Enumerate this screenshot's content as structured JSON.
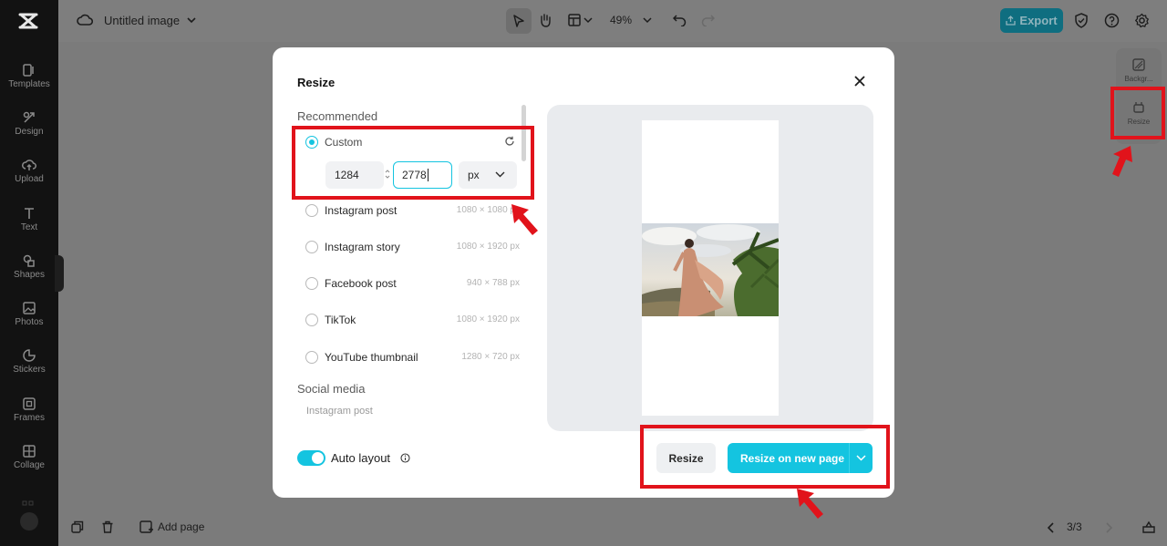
{
  "app": {
    "document_title": "Untitled image",
    "zoom": "49%",
    "export_label": "Export",
    "accent": "#14c4e0",
    "annotation_color": "#e1131b"
  },
  "sidebar": {
    "items": [
      {
        "label": "Templates",
        "icon": "templates-icon"
      },
      {
        "label": "Design",
        "icon": "design-icon"
      },
      {
        "label": "Upload",
        "icon": "upload-icon"
      },
      {
        "label": "Text",
        "icon": "text-icon"
      },
      {
        "label": "Shapes",
        "icon": "shapes-icon"
      },
      {
        "label": "Photos",
        "icon": "photos-icon"
      },
      {
        "label": "Stickers",
        "icon": "stickers-icon"
      },
      {
        "label": "Frames",
        "icon": "frames-icon"
      },
      {
        "label": "Collage",
        "icon": "collage-icon"
      }
    ]
  },
  "right_panel": {
    "background_label": "Backgr...",
    "resize_label": "Resize"
  },
  "bottom_bar": {
    "add_page_label": "Add page",
    "page_count": "3/3"
  },
  "modal": {
    "title": "Resize",
    "recommended_heading": "Recommended",
    "custom": {
      "label": "Custom",
      "width": "1284",
      "height": "2778",
      "unit": "px"
    },
    "presets": [
      {
        "label": "Instagram post",
        "size": "1080 × 1080 px"
      },
      {
        "label": "Instagram story",
        "size": "1080 × 1920 px"
      },
      {
        "label": "Facebook post",
        "size": "940 × 788 px"
      },
      {
        "label": "TikTok",
        "size": "1080 × 1920 px"
      },
      {
        "label": "YouTube thumbnail",
        "size": "1280 × 720 px"
      }
    ],
    "social_heading": "Social media",
    "social_first_item": "Instagram post",
    "auto_layout_label": "Auto layout",
    "auto_layout_on": true,
    "resize_button": "Resize",
    "resize_new_page_button": "Resize on new page"
  }
}
